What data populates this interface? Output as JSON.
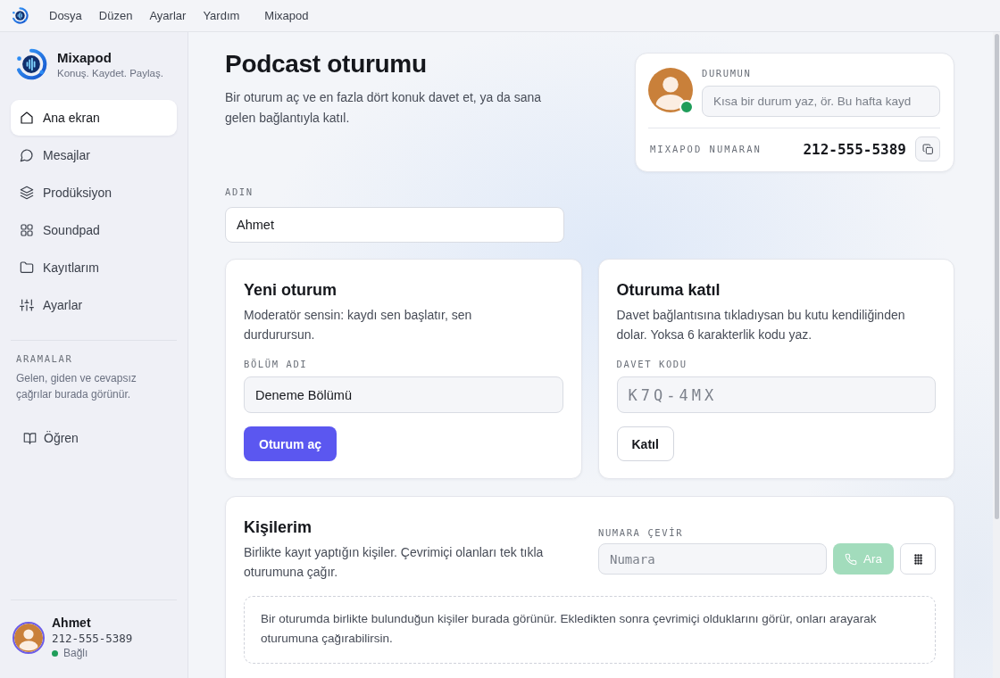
{
  "menubar": {
    "items": [
      {
        "label": "Dosya"
      },
      {
        "label": "Düzen"
      },
      {
        "label": "Ayarlar"
      },
      {
        "label": "Yardım"
      }
    ],
    "app_name": "Mixapod"
  },
  "sidebar": {
    "brand": {
      "name": "Mixapod",
      "tagline": "Konuş. Kaydet. Paylaş."
    },
    "nav": [
      {
        "label": "Ana ekran",
        "selected": true
      },
      {
        "label": "Mesajlar",
        "selected": false
      },
      {
        "label": "Prodüksiyon",
        "selected": false
      },
      {
        "label": "Soundpad",
        "selected": false
      },
      {
        "label": "Kayıtlarım",
        "selected": false
      },
      {
        "label": "Ayarlar",
        "selected": false
      }
    ],
    "calls": {
      "title": "ARAMALAR",
      "note": "Gelen, giden ve cevapsız çağrılar burada görünür."
    },
    "learn": {
      "label": "Öğren"
    },
    "user": {
      "name": "Ahmet",
      "number": "212-555-5389",
      "status": "Bağlı",
      "online": true
    }
  },
  "header": {
    "title": "Podcast oturumu",
    "subtitle": "Bir oturum aç ve en fazla dört konuk davet et, ya da sana gelen bağlantıyla katıl."
  },
  "status_card": {
    "status_label": "DURUMUN",
    "status_placeholder": "Kısa bir durum yaz, ör. Bu hafta kayd",
    "online": true,
    "number_label": "MIXAPOD NUMARAN",
    "number": "212-555-5389"
  },
  "name_field": {
    "label": "ADIN",
    "value": "Ahmet"
  },
  "cards": [
    {
      "title": "Yeni oturum",
      "description": "Moderatör sensin: kaydı sen başlatır, sen durdurursun.",
      "field_label": "BÖLÜM ADI",
      "field_value": "Deneme Bölümü",
      "button": "Oturum aç",
      "kind": "primary"
    },
    {
      "title": "Oturuma katıl",
      "description": "Davet bağlantısına tıkladıysan bu kutu kendiliğinden dolar. Yoksa 6 karakterlik kodu yaz.",
      "field_label": "DAVET KODU",
      "field_placeholder": "K7Q-4MX",
      "button": "Katıl",
      "kind": "secondary"
    }
  ],
  "contacts": {
    "title": "Kişilerim",
    "description": "Birlikte kayıt yaptığın kişiler. Çevrimiçi olanları tek tıkla oturumuna çağır.",
    "dial_label": "NUMARA ÇEVİR",
    "dial_placeholder": "Numara",
    "call_button": {
      "label": "Ara",
      "disabled": true
    },
    "empty_note": "Bir oturumda birlikte bulunduğun kişiler burada görünür. Ekledikten sonra çevrimiçi olduklarını görür, onları arayarak oturumuna çağırabilirsin."
  }
}
